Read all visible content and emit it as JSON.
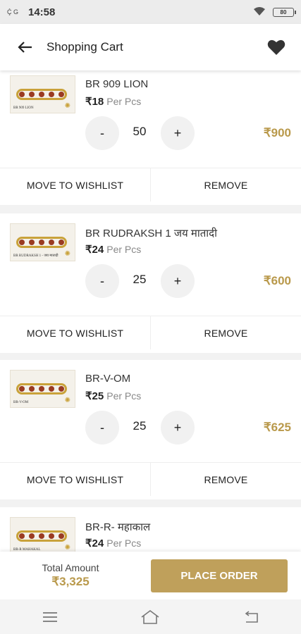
{
  "status_bar": {
    "signal": "Ḉ G",
    "time": "14:58",
    "battery": "80"
  },
  "app_bar": {
    "title": "Shopping Cart"
  },
  "cart": {
    "items": [
      {
        "name": "BR 909 LION",
        "thumb_label": "BR 909 LION",
        "price": "₹18",
        "unit": "Per Pcs",
        "minus": "-",
        "plus": "+",
        "qty": "50",
        "line_total": "₹900",
        "wishlist": "MOVE TO WISHLIST",
        "remove": "REMOVE"
      },
      {
        "name": "BR RUDRAKSH 1  जय मातादी",
        "thumb_label": "BR RUDRAKSH 1 - जय मातादी",
        "price": "₹24",
        "unit": "Per Pcs",
        "minus": "-",
        "plus": "+",
        "qty": "25",
        "line_total": "₹600",
        "wishlist": "MOVE TO WISHLIST",
        "remove": "REMOVE"
      },
      {
        "name": "BR-V-OM",
        "thumb_label": "BR-V-OM",
        "price": "₹25",
        "unit": "Per Pcs",
        "minus": "-",
        "plus": "+",
        "qty": "25",
        "line_total": "₹625",
        "wishlist": "MOVE TO WISHLIST",
        "remove": "REMOVE"
      },
      {
        "name": "BR-R- महाकाल",
        "thumb_label": "BR-R MAHAKAL",
        "price": "₹24",
        "unit": "Per Pcs"
      }
    ]
  },
  "footer": {
    "total_label": "Total Amount",
    "total_amount": "₹3,325",
    "place_order": "PLACE ORDER"
  },
  "colors": {
    "accent": "#bfa05b",
    "price_gold": "#b9994b"
  }
}
